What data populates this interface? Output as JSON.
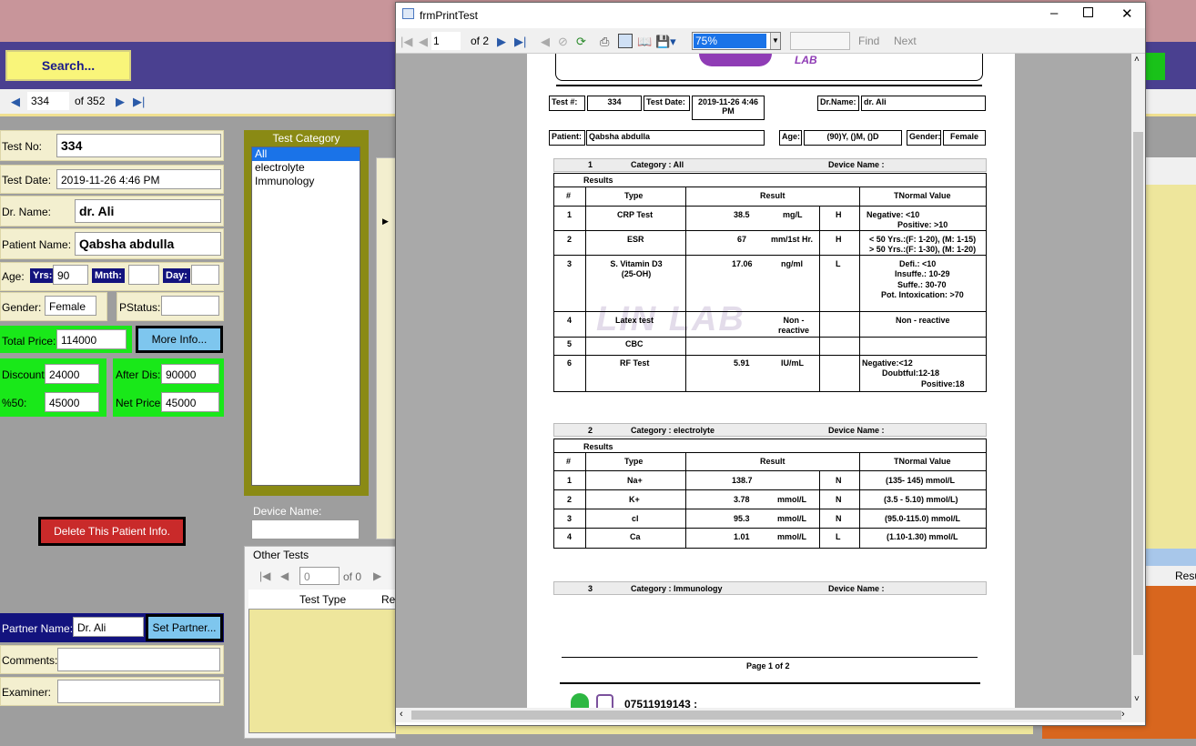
{
  "app": {
    "search_label": "Search...",
    "nav": {
      "position": "334",
      "of_label": "of 352"
    },
    "fields": {
      "test_no_label": "Test No:",
      "test_no": "334",
      "test_date_label": "Test Date:",
      "test_date": "2019-11-26 4:46 PM",
      "dr_name_label": "Dr. Name:",
      "dr_name": "dr. Ali",
      "patient_name_label": "Patient Name:",
      "patient_name": "Qabsha abdulla",
      "age_label": "Age:",
      "yrs_label": "Yrs:",
      "yrs": "90",
      "mnth_label": "Mnth:",
      "mnth": "",
      "day_label": "Day:",
      "day": "",
      "gender_label": "Gender:",
      "gender": "Female",
      "pstatus_label": "PStatus:",
      "pstatus": "",
      "total_price_label": "Total Price:",
      "total_price": "114000",
      "more_info_label": "More Info...",
      "discount_label": "Discount:",
      "discount": "24000",
      "after_dis_label": "After Dis:",
      "after_dis": "90000",
      "pct50_label": "%50:",
      "pct50": "45000",
      "net_price_label": "Net Price:",
      "net_price": "45000",
      "delete_label": "Delete This Patient Info.",
      "partner_name_label": "Partner Name:",
      "partner_name": "Dr. Ali",
      "set_partner_label": "Set Partner...",
      "comments_label": "Comments:",
      "comments": "",
      "examiner_label": "Examiner:",
      "examiner": ""
    },
    "test_category": {
      "title": "Test Category",
      "items": [
        "All",
        "electrolyte",
        "Immunology"
      ],
      "selected": "All"
    },
    "device_name_label": "Device Name:",
    "other_tests": {
      "title": "Other Tests",
      "page_value": "0",
      "of_label": "of 0",
      "col_test_type": "Test Type",
      "col_res": "Re",
      "right_col": "Resu"
    }
  },
  "dialog": {
    "title": "frmPrintTest",
    "page": "1",
    "of_pages": "of 2",
    "zoom": "75%",
    "find_label": "Find",
    "next_label": "Next"
  },
  "report": {
    "test_no_label": "Test #:",
    "test_no": "334",
    "test_date_label": "Test Date:",
    "test_date": "2019-11-26 4:46 PM",
    "dr_label": "Dr.Name:",
    "dr_name": "dr. Ali",
    "patient_label": "Patient:",
    "patient": "Qabsha abdulla",
    "age_label": "Age:",
    "age": "(90)Y, ()M, ()D",
    "gender_label": "Gender:",
    "gender": "Female",
    "results_label": "Results",
    "col_num": "#",
    "col_type": "Type",
    "col_result": "Result",
    "col_normal": "TNormal Value",
    "device_label": "Device Name :",
    "categories": [
      {
        "num": "1",
        "name": "Category : All"
      },
      {
        "num": "2",
        "name": "Category : electrolyte"
      },
      {
        "num": "3",
        "name": "Category : Immunology"
      }
    ],
    "rows_all": [
      {
        "num": "1",
        "type": "CRP Test",
        "value": "38.5",
        "unit": "mg/L",
        "flag": "H",
        "normal": [
          "Negative: <10",
          "Positive: >10"
        ]
      },
      {
        "num": "2",
        "type": "ESR",
        "value": "67",
        "unit": "mm/1st Hr.",
        "flag": "H",
        "normal": [
          "< 50 Yrs.:(F: 1-20), (M: 1-15)",
          "> 50 Yrs.:(F: 1-30), (M: 1-20)"
        ]
      },
      {
        "num": "3",
        "type": "S. Vitamin D3 (25-OH)",
        "value": "17.06",
        "unit": "ng/ml",
        "flag": "L",
        "normal": [
          "Defi.: <10",
          "Insuffe.: 10-29",
          "Suffe.: 30-70",
          "Pot. Intoxication: >70"
        ]
      },
      {
        "num": "4",
        "type": "Latex test",
        "value": "",
        "unit": "Non - reactive",
        "flag": "",
        "normal": [
          "Non - reactive"
        ]
      },
      {
        "num": "5",
        "type": "CBC",
        "value": "",
        "unit": "",
        "flag": "",
        "normal": []
      },
      {
        "num": "6",
        "type": "RF Test",
        "value": "5.91",
        "unit": "IU/mL",
        "flag": "",
        "normal": [
          "Negative:<12",
          "Doubtful:12-18",
          "Positive:18"
        ]
      }
    ],
    "rows_electrolyte": [
      {
        "num": "1",
        "type": "Na+",
        "value": "138.7",
        "unit": "",
        "flag": "N",
        "normal": "(135- 145)  mmol/L"
      },
      {
        "num": "2",
        "type": "K+",
        "value": "3.78",
        "unit": "mmol/L",
        "flag": "N",
        "normal": "(3.5 - 5.10)  mmol/L)"
      },
      {
        "num": "3",
        "type": "cl",
        "value": "95.3",
        "unit": "mmol/L",
        "flag": "N",
        "normal": "(95.0-115.0) mmol/L"
      },
      {
        "num": "4",
        "type": "Ca",
        "value": "1.01",
        "unit": "mmol/L",
        "flag": "L",
        "normal": "(1.10-1.30) mmol/L"
      }
    ],
    "page_footer": "Page 1 of 2",
    "phone": "07511919143 :",
    "watermark": "LIN LAB",
    "logo_text": "LAB"
  }
}
